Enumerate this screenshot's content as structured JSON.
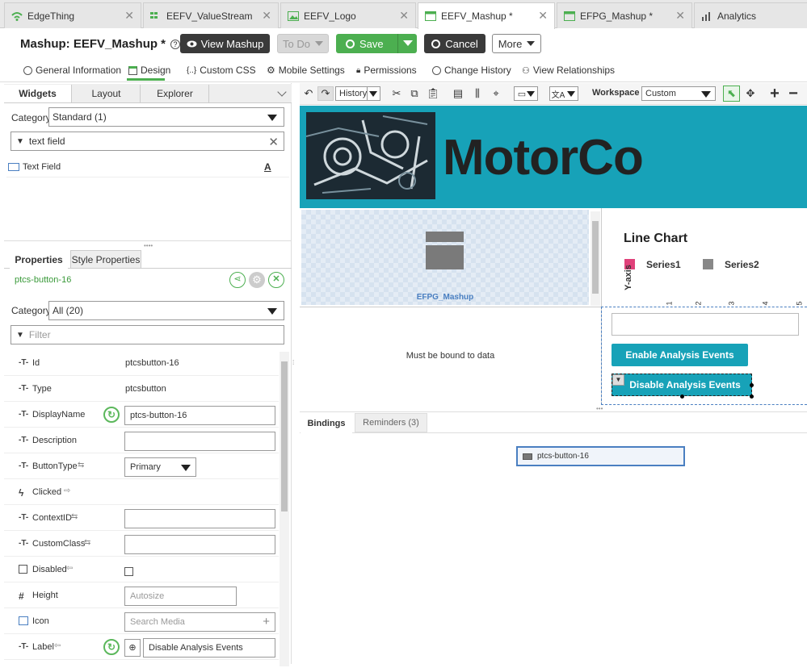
{
  "tabs": [
    {
      "label": "EdgeThing",
      "icon": "wifi-icon"
    },
    {
      "label": "EEFV_ValueStream",
      "icon": "value-stream-icon"
    },
    {
      "label": "EEFV_Logo",
      "icon": "image-icon"
    },
    {
      "label": "EEFV_Mashup *",
      "icon": "mashup-icon"
    },
    {
      "label": "EFPG_Mashup *",
      "icon": "mashup-icon"
    },
    {
      "label": "Analytics",
      "icon": "analytics-icon"
    }
  ],
  "header": {
    "title": "Mashup: EEFV_Mashup *",
    "help": "?",
    "view_mashup": "View Mashup",
    "todo": "To Do",
    "save": "Save",
    "cancel": "Cancel",
    "more": "More"
  },
  "subnav": [
    "General Information",
    "Design",
    "Custom CSS",
    "Mobile Settings",
    "Permissions",
    "Change History",
    "View Relationships"
  ],
  "left": {
    "tabs": [
      "Widgets",
      "Layout",
      "Explorer"
    ],
    "category_label": "Category",
    "category_value": "Standard (1)",
    "search_value": "text field",
    "result_label": "Text Field",
    "props_tabs": [
      "Properties",
      "Style Properties"
    ],
    "widget_id": "ptcs-button-16",
    "prop_category_label": "Category",
    "prop_category_value": "All (20)",
    "filter_placeholder": "Filter",
    "rows": [
      {
        "name": "Id",
        "value": "ptcsbutton-16"
      },
      {
        "name": "Type",
        "value": "ptcsbutton"
      },
      {
        "name": "DisplayName",
        "value": "ptcs-button-16"
      },
      {
        "name": "Description",
        "value": ""
      },
      {
        "name": "ButtonType",
        "value": "Primary"
      },
      {
        "name": "Clicked",
        "value": ""
      },
      {
        "name": "ContextID",
        "value": ""
      },
      {
        "name": "CustomClass",
        "value": ""
      },
      {
        "name": "Disabled",
        "value": ""
      },
      {
        "name": "Height",
        "value": "Autosize"
      },
      {
        "name": "Icon",
        "value": "Search Media"
      },
      {
        "name": "Label",
        "value": "Disable Analysis Events"
      }
    ]
  },
  "toolbar": {
    "history": "History",
    "workspace_label": "Workspace",
    "workspace_value": "Custom"
  },
  "canvas": {
    "logo_text": "MotorCo",
    "embedded_label": "EFPG_Mashup",
    "placeholder": "Must be bound to data",
    "chart_title": "Line Chart",
    "series": [
      {
        "name": "Series1",
        "color": "#e0417a"
      },
      {
        "name": "Series2",
        "color": "#888888"
      }
    ],
    "yaxis": "Y-axis",
    "xticks": [
      "1",
      "2",
      "3",
      "4",
      "5"
    ],
    "enable_btn": "Enable Analysis Events",
    "disable_btn": "Disable Analysis Events",
    "accent": "#17a2b8"
  },
  "bottom": {
    "tabs": [
      "Bindings",
      "Reminders (3)"
    ],
    "node": "ptcs-button-16"
  }
}
